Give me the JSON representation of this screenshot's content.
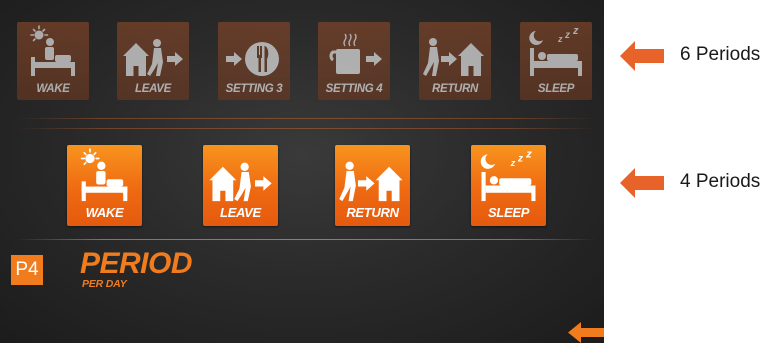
{
  "colors": {
    "accent": "#f07c1e",
    "screen_bg": "#2b2b2b",
    "annotation_arrow": "#e8632a"
  },
  "six_period_row": {
    "items": [
      {
        "label": "WAKE",
        "icon": "wake-icon"
      },
      {
        "label": "LEAVE",
        "icon": "leave-icon"
      },
      {
        "label": "SETTING 3",
        "icon": "dining-icon"
      },
      {
        "label": "SETTING 4",
        "icon": "coffee-icon"
      },
      {
        "label": "RETURN",
        "icon": "return-icon"
      },
      {
        "label": "SLEEP",
        "icon": "sleep-icon"
      }
    ]
  },
  "four_period_row": {
    "items": [
      {
        "label": "WAKE",
        "icon": "wake-icon"
      },
      {
        "label": "LEAVE",
        "icon": "leave-icon"
      },
      {
        "label": "RETURN",
        "icon": "return-icon"
      },
      {
        "label": "SLEEP",
        "icon": "sleep-icon"
      }
    ]
  },
  "period_setting": {
    "badge": "P4",
    "title": "PERIOD",
    "subtitle": "PER DAY"
  },
  "annotations": {
    "six_periods": "6 Periods",
    "four_periods": "4 Periods"
  }
}
